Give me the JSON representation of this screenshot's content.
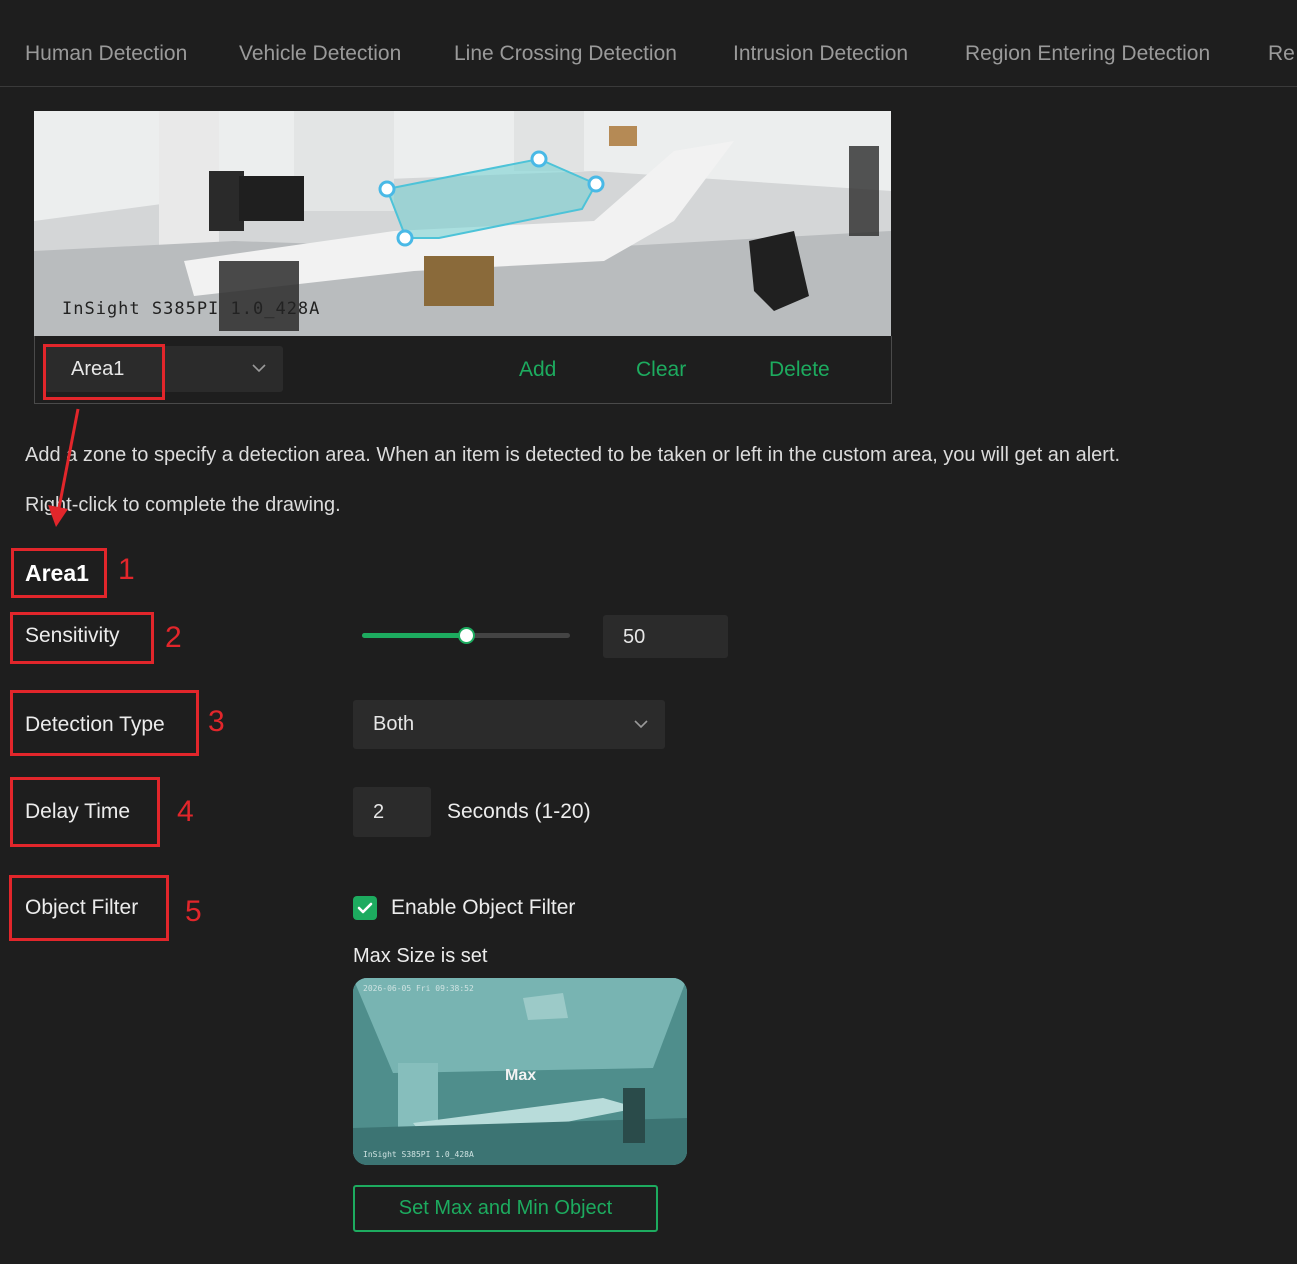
{
  "tabs": [
    "Human Detection",
    "Vehicle Detection",
    "Line Crossing Detection",
    "Intrusion Detection",
    "Region Entering Detection",
    "Re"
  ],
  "preview": {
    "osd_text": "InSight S385PI 1.0_428A"
  },
  "toolbar": {
    "area_selected": "Area1",
    "add_label": "Add",
    "clear_label": "Clear",
    "delete_label": "Delete"
  },
  "help": {
    "line1": "Add a zone to specify a detection area. When an item is detected to be taken or left in the custom area, you will get an alert.",
    "line2": "Right-click to complete the drawing."
  },
  "area_title": "Area1",
  "sensitivity": {
    "label": "Sensitivity",
    "value": "50",
    "level": 0.5
  },
  "detection_type": {
    "label": "Detection Type",
    "value": "Both"
  },
  "delay_time": {
    "label": "Delay Time",
    "value": "2",
    "unit": "Seconds (1-20)"
  },
  "object_filter": {
    "label": "Object Filter",
    "checkbox_label": "Enable Object Filter",
    "checked": true,
    "max_status": "Max Size is set",
    "thumb_label": "Max",
    "button_label": "Set Max and Min Object"
  },
  "annotations": [
    "1",
    "2",
    "3",
    "4",
    "5"
  ],
  "colors": {
    "accent": "#1dab5f",
    "annotation": "#e2262b",
    "background": "#1e1e1e"
  }
}
